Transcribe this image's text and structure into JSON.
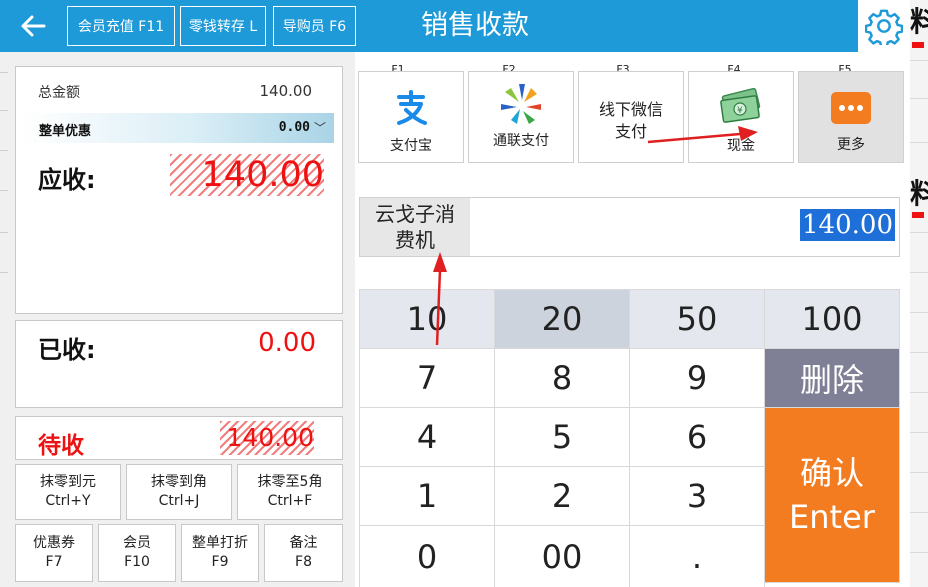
{
  "header": {
    "title": "销售收款",
    "buttons": [
      {
        "label": "会员充值 F11"
      },
      {
        "label": "零钱转存 L"
      },
      {
        "label": "导购员 F6"
      }
    ]
  },
  "summary": {
    "total_label": "总金额",
    "total_value": "140.00",
    "discount_label": "整单优惠",
    "discount_value": "0.00",
    "due_label": "应收:",
    "due_value": "140.00",
    "paid_label": "已收:",
    "paid_value": "0.00",
    "pending_label": "待收",
    "pending_value": "140.00"
  },
  "shortcuts": [
    {
      "line1": "抹零到元",
      "line2": "Ctrl+Y"
    },
    {
      "line1": "抹零到角",
      "line2": "Ctrl+J"
    },
    {
      "line1": "抹零至5角",
      "line2": "Ctrl+F"
    },
    {
      "line1": "优惠券",
      "line2": "F7"
    },
    {
      "line1": "会员",
      "line2": "F10"
    },
    {
      "line1": "整单打折",
      "line2": "F9"
    },
    {
      "line1": "备注",
      "line2": "F8"
    }
  ],
  "payment_methods": [
    {
      "key": "F1",
      "label": "支付宝",
      "icon": "alipay-icon"
    },
    {
      "key": "F2",
      "label": "通联支付",
      "icon": "allinpay-icon"
    },
    {
      "key": "F3",
      "label_line1": "线下微信",
      "label_line2": "支付"
    },
    {
      "key": "F4",
      "label": "现金",
      "icon": "cash-icon"
    },
    {
      "key": "F5",
      "label": "更多",
      "icon": "more-icon"
    }
  ],
  "terminal": {
    "label_line1": "云戈子消",
    "label_line2": "费机",
    "amount": "140.00"
  },
  "keypad": {
    "quick": [
      "10",
      "20",
      "50",
      "100"
    ],
    "row2": [
      "7",
      "8",
      "9"
    ],
    "row3": [
      "4",
      "5",
      "6"
    ],
    "row4": [
      "1",
      "2",
      "3"
    ],
    "row5": [
      "0",
      "00",
      "."
    ],
    "delete_label": "删除",
    "enter_line1": "确认",
    "enter_line2": "Enter"
  },
  "edge": {
    "chars": [
      "料",
      "料"
    ]
  },
  "colors": {
    "header": "#1e9ad8",
    "accent_red": "#e11111",
    "enter": "#f47c20",
    "delete": "#7f8095",
    "annotation_arrow": "#e02020"
  }
}
